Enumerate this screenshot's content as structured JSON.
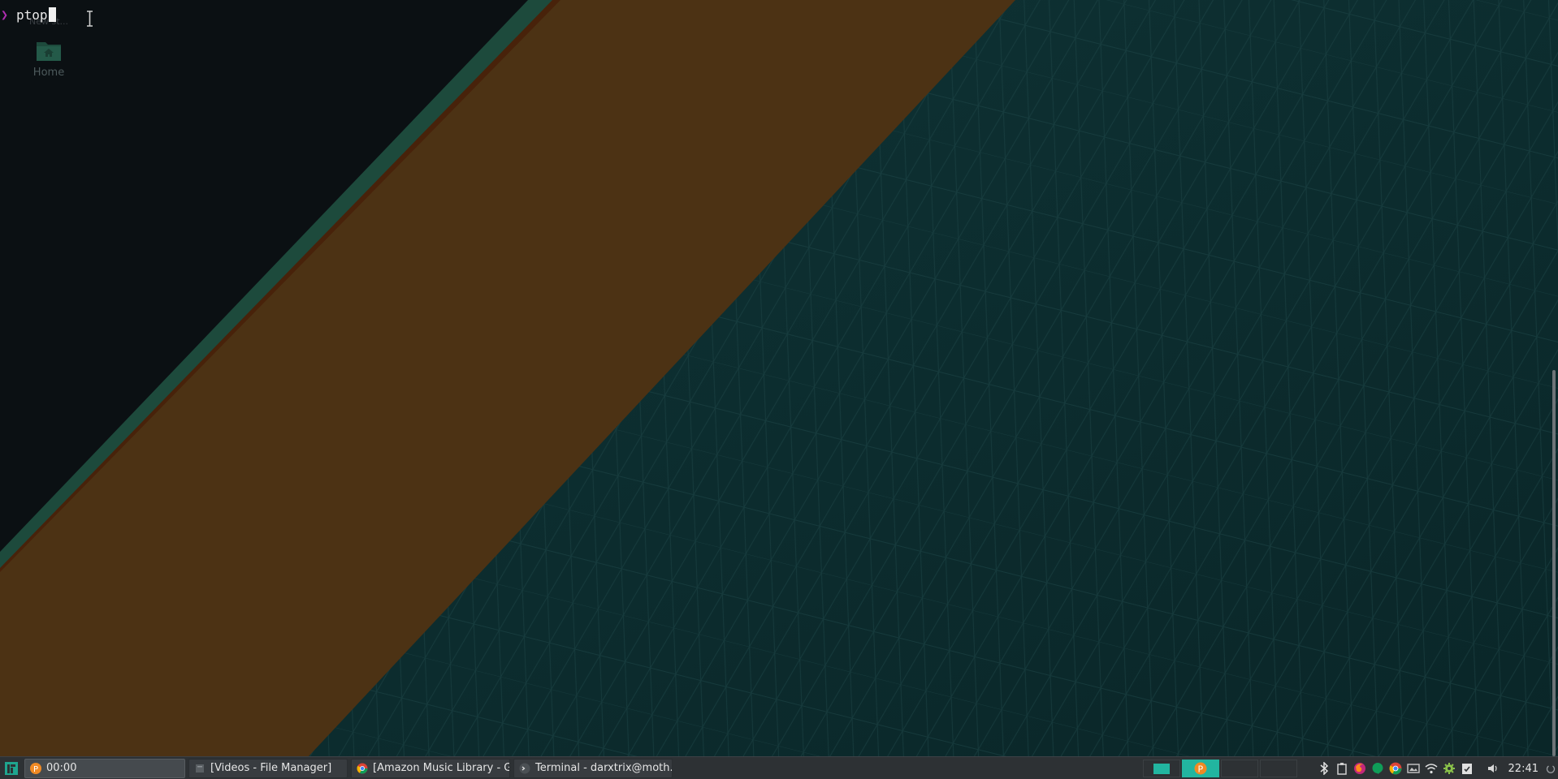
{
  "terminal": {
    "command": "ptop",
    "ghost_text": "New st..."
  },
  "desktop": {
    "home_label": "Home"
  },
  "taskbar": {
    "tasks": [
      {
        "label": "00:00",
        "icon": "pomodoro-icon"
      },
      {
        "label": "[Videos - File Manager]",
        "icon": "file-manager-icon"
      },
      {
        "label": "[Amazon Music Library - G...",
        "icon": "chrome-icon"
      },
      {
        "label": "Terminal - darxtrix@moth...",
        "icon": "terminal-icon"
      }
    ],
    "clock": "22:41"
  },
  "colors": {
    "terminal_bg": "#0b1013",
    "stripe_dark_teal": "#1d4a3c",
    "stripe_orange_dark": "#4a2409",
    "stripe_orange_light": "#4d3213",
    "wallpaper_teal": "#0d2c2f",
    "taskbar_bg": "#2d3134",
    "accent_teal": "#22b5a0",
    "prompt": "#b02db0"
  }
}
